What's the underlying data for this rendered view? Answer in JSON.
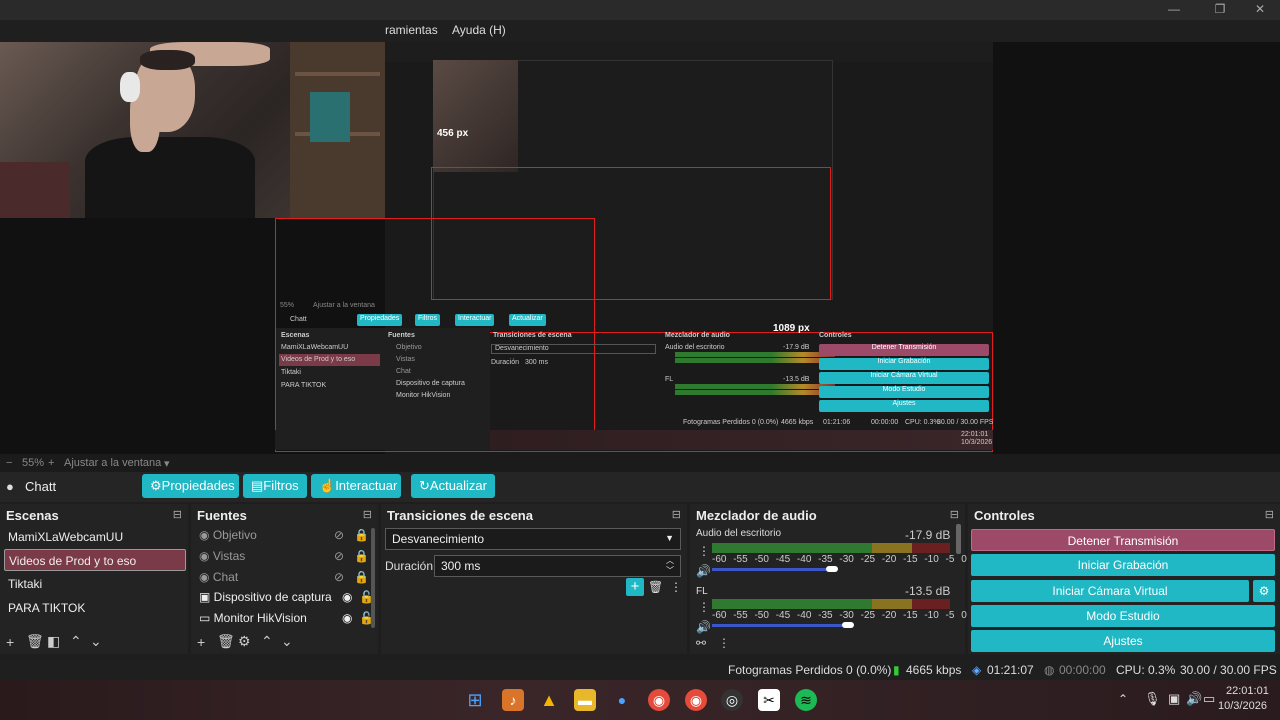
{
  "menu": {
    "tools": "ramientas",
    "help": "Ayuda (H)"
  },
  "preview": {
    "measure_height": "456 px",
    "measure_width": "1089 px",
    "nested": {
      "scene_label": "Chatt",
      "btn_props": "Propiedades",
      "btn_filters": "Filtros",
      "btn_interact": "Interactuar",
      "btn_refresh": "Actualizar",
      "zoom": "55%",
      "fit": "Ajustar a la ventana",
      "scenes_title": "Escenas",
      "sources_title": "Fuentes",
      "transitions_title": "Transiciones de escena",
      "mixer_title": "Mezclador de audio",
      "controls_title": "Controles",
      "scenes": [
        "MamiXLaWebcamUU",
        "Videos de Prod y to eso",
        "Tiktaki",
        "PARA TIKTOK"
      ],
      "sources": [
        "Objetivo",
        "Vistas",
        "Chat",
        "Dispositivo de captura",
        "Monitor HikVision"
      ],
      "transition": "Desvanecimiento",
      "duration_label": "Duración",
      "duration": "300 ms",
      "desktop_audio": "Audio del escritorio",
      "desktop_db": "-17.9 dB",
      "fl_label": "FL",
      "fl_db": "-13.5 dB",
      "controls": [
        "Detener Transmisión",
        "Iniciar Grabación",
        "Iniciar Cámara Virtual",
        "Modo Estudio",
        "Ajustes"
      ],
      "status": "Fotogramas Perdidos 0 (0.0%)",
      "kbps": "4665 kbps",
      "time": "01:21:06",
      "rec_time": "00:00:00",
      "cpu": "CPU: 0.3%",
      "fps": "30.00 / 30.00 FPS",
      "clock_time": "22:01:01",
      "clock_date": "10/3/2026"
    }
  },
  "zoom": {
    "percent": "55%",
    "fit_label": "Ajustar a la ventana"
  },
  "scenebar": {
    "scene_name": "Chatt",
    "props": "Propiedades",
    "filters": "Filtros",
    "interact": "Interactuar",
    "refresh": "Actualizar"
  },
  "scenes": {
    "title": "Escenas",
    "items": [
      "MamiXLaWebcamUU",
      "Videos de Prod y to eso",
      "Tiktaki",
      "PARA TIKTOK"
    ],
    "selected_index": 1
  },
  "sources": {
    "title": "Fuentes",
    "items": [
      {
        "name": "Objetivo",
        "visible": false
      },
      {
        "name": "Vistas",
        "visible": false
      },
      {
        "name": "Chat",
        "visible": false
      },
      {
        "name": "Dispositivo de captura",
        "visible": true
      },
      {
        "name": "Monitor HikVision",
        "visible": true
      }
    ]
  },
  "transitions": {
    "title": "Transiciones de escena",
    "selected": "Desvanecimiento",
    "duration_label": "Duración",
    "duration": "300 ms"
  },
  "mixer": {
    "title": "Mezclador de audio",
    "channels": [
      {
        "name": "Audio del escritorio",
        "db": "-17.9 dB",
        "level": 0.78
      },
      {
        "name": "FL",
        "db": "-13.5 dB",
        "level": 0.82
      }
    ],
    "scale": "-60 -55 -50 -45 -40 -35 -30 -25 -20 -15 -10 -5 0"
  },
  "controls": {
    "title": "Controles",
    "stop_stream": "Detener Transmisión",
    "start_rec": "Iniciar Grabación",
    "start_vcam": "Iniciar Cámara Virtual",
    "studio": "Modo Estudio",
    "settings": "Ajustes"
  },
  "status": {
    "dropped": "Fotogramas Perdidos 0 (0.0%)",
    "kbps": "4665 kbps",
    "stream_time": "01:21:07",
    "rec_time": "00:00:00",
    "cpu": "CPU: 0.3%",
    "fps": "30.00 / 30.00 FPS"
  },
  "taskbar": {
    "time": "22:01:01",
    "date": "10/3/2026"
  },
  "colors": {
    "accent": "#1fb8c4",
    "stop": "#9c4a68",
    "selected": "#7a3a47",
    "measure": "#e01e1e"
  }
}
